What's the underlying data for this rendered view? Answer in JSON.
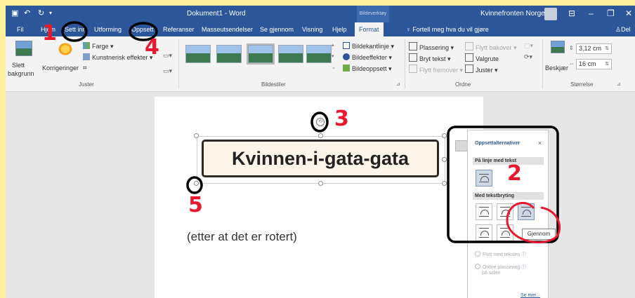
{
  "titlebar": {
    "doc_title": "Dokument1 - Word",
    "context_label": "Bildeverktøy",
    "user": "Kvinnefronten Norge"
  },
  "tabs": [
    {
      "label": "Fil"
    },
    {
      "label": "Hjem"
    },
    {
      "label": "Sett inn"
    },
    {
      "label": "Utforming"
    },
    {
      "label": "Oppsett"
    },
    {
      "label": "Referanser"
    },
    {
      "label": "Masseutsendelser"
    },
    {
      "label": "Se gjennom"
    },
    {
      "label": "Visning"
    },
    {
      "label": "Hjelp"
    },
    {
      "label": "Format"
    }
  ],
  "tell_me": "Fortell meg hva du vil gjøre",
  "share": "Del",
  "ribbon": {
    "remove_bg": [
      "Slett",
      "bakgrunn"
    ],
    "corrections": "Korrigeringer",
    "color": "Farge",
    "artistic": "Kunstnerisk effekter",
    "adjust_group": "Juster",
    "styles_group": "Bildestiler",
    "border": "Bildekantlinje",
    "effects": "Bildeeffekter",
    "layout": "Bildeoppsett",
    "position": "Plassering",
    "wrap": "Bryt tekst",
    "bring_forward": "Flytt fremover",
    "send_backward": "Flytt bakover",
    "selection_pane": "Valgrute",
    "align": "Juster",
    "arrange_group": "Ordne",
    "crop": "Beskjær",
    "height": "3,12 cm",
    "width": "16 cm",
    "size_group": "Størrelse"
  },
  "document": {
    "textbox_text": "Kvinnen-i-gata-gata",
    "body_text": "(etter at det er rotert)"
  },
  "layout_panel": {
    "title": "Oppsettalternativer",
    "in_line": "På linje med tekst",
    "with_wrap": "Med tekstbryting",
    "move_with_text": "Flytt med teksten",
    "fix_position": "Ordne plassering",
    "on_page": "på siden",
    "see_more": "Se mer...",
    "tooltip": "Gjennom"
  },
  "annotations": [
    "1",
    "2",
    "3",
    "4",
    "5"
  ],
  "colors": {
    "word_blue": "#2b579a",
    "annotation_red": "#e8182e",
    "annotation_black": "#000000",
    "background_yellow": "#fdef9c"
  }
}
